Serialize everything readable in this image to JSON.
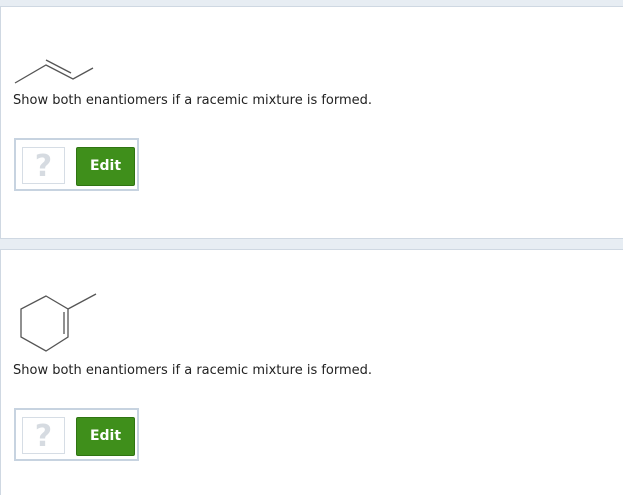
{
  "questions": [
    {
      "molecule": "but-2-ene-skeletal",
      "prompt": "Show both enantiomers if a racemic mixture is formed.",
      "answer_placeholder": "?",
      "edit_label": "Edit"
    },
    {
      "molecule": "1-methylcyclohexene-skeletal",
      "prompt": "Show both enantiomers if a racemic mixture is formed.",
      "answer_placeholder": "?",
      "edit_label": "Edit"
    }
  ],
  "colors": {
    "page_background": "#e7edf3",
    "panel_background": "#ffffff",
    "edit_button": "#3f8f1b",
    "bond_line": "#555555",
    "placeholder_mark": "#d6dbe1"
  }
}
